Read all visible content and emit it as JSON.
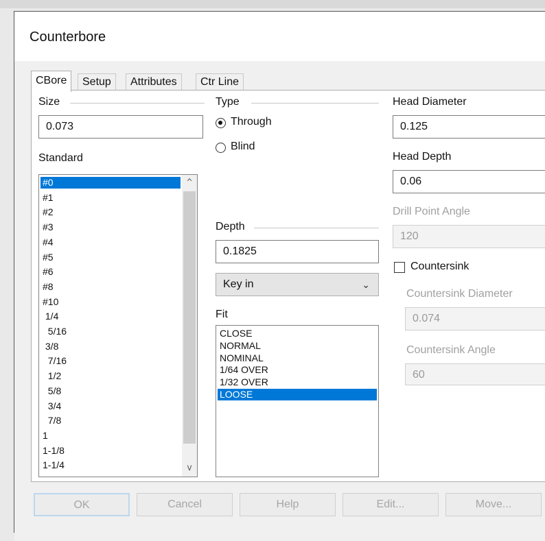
{
  "dialog": {
    "title": "Counterbore"
  },
  "tabs": [
    "CBore",
    "Setup",
    "Attributes",
    "Ctr Line"
  ],
  "size": {
    "label": "Size",
    "value": "0.073"
  },
  "standard": {
    "label": "Standard",
    "items": [
      "#0",
      "#1",
      "#2",
      "#3",
      "#4",
      "#5",
      "#6",
      "#8",
      "#10",
      " 1/4",
      "  5/16",
      " 3/8",
      "  7/16",
      "  1/2",
      "  5/8",
      "  3/4",
      "  7/8",
      "1",
      "1-1/8",
      "1-1/4"
    ],
    "selected": "#0"
  },
  "type": {
    "label": "Type",
    "options": [
      "Through",
      "Blind"
    ],
    "selected": "Through"
  },
  "depth": {
    "label": "Depth",
    "value": "0.1825"
  },
  "depth_mode": {
    "value": "Key in"
  },
  "fit": {
    "label": "Fit",
    "items": [
      "CLOSE",
      "NORMAL",
      "NOMINAL",
      "1/64 OVER",
      "1/32 OVER",
      "LOOSE"
    ],
    "selected": "LOOSE"
  },
  "head_diameter": {
    "label": "Head Diameter",
    "value": "0.125"
  },
  "head_depth": {
    "label": "Head Depth",
    "value": "0.06"
  },
  "drill_point_angle": {
    "label": "Drill Point Angle",
    "value": "120"
  },
  "countersink": {
    "label": "Countersink",
    "checked": false
  },
  "countersink_diameter": {
    "label": "Countersink Diameter",
    "value": "0.074"
  },
  "countersink_angle": {
    "label": "Countersink Angle",
    "value": "60"
  },
  "buttons": {
    "ok": "OK",
    "cancel": "Cancel",
    "help": "Help",
    "edit": "Edit...",
    "move": "Move..."
  },
  "colors": {
    "selection": "#0078d7",
    "disabled_text": "#a0a0a0"
  }
}
